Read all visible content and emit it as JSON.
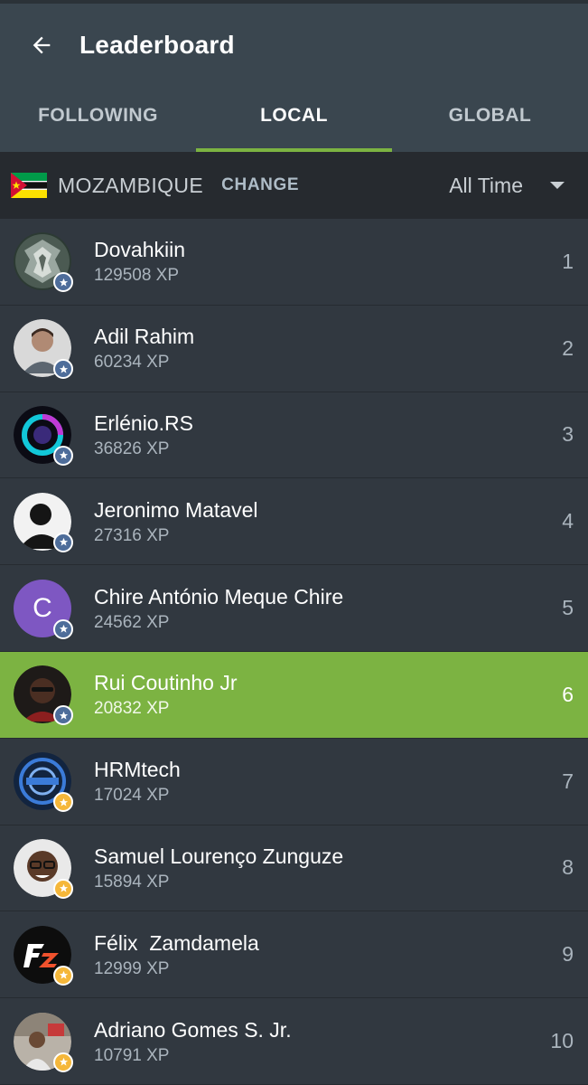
{
  "header": {
    "title": "Leaderboard",
    "back_icon": "arrow-left-icon"
  },
  "tabs": [
    {
      "label": "FOLLOWING",
      "active": false
    },
    {
      "label": "LOCAL",
      "active": true
    },
    {
      "label": "GLOBAL",
      "active": false
    }
  ],
  "filter": {
    "country": "MOZAMBIQUE",
    "change_label": "CHANGE",
    "period": "All Time",
    "flag_icon": "mozambique-flag-icon"
  },
  "colors": {
    "accent": "#7cb342",
    "appbar": "#3a464f",
    "row": "#313840"
  },
  "entries": [
    {
      "name": "Dovahkiin",
      "xp": "129508 XP",
      "rank": "1",
      "badge": "blue",
      "avatar": "dragon"
    },
    {
      "name": "Adil Rahim",
      "xp": "60234 XP",
      "rank": "2",
      "badge": "blue",
      "avatar": "photo-grey"
    },
    {
      "name": "Erlénio.RS",
      "xp": "36826 XP",
      "rank": "3",
      "badge": "blue",
      "avatar": "ring"
    },
    {
      "name": "Jeronimo Matavel",
      "xp": "27316 XP",
      "rank": "4",
      "badge": "blue",
      "avatar": "silhouette"
    },
    {
      "name": "Chire António Meque Chire",
      "xp": "24562 XP",
      "rank": "5",
      "badge": "blue",
      "avatar": "letter",
      "letter": "C"
    },
    {
      "name": "Rui Coutinho Jr",
      "xp": "20832 XP",
      "rank": "6",
      "badge": "blue",
      "avatar": "photo-dark",
      "highlight": true
    },
    {
      "name": "HRMtech",
      "xp": "17024 XP",
      "rank": "7",
      "badge": "gold",
      "avatar": "logo-blue"
    },
    {
      "name": "Samuel Lourenço Zunguze",
      "xp": "15894 XP",
      "rank": "8",
      "badge": "gold",
      "avatar": "photo-face"
    },
    {
      "name": "Félix  Zamdamela",
      "xp": "12999 XP",
      "rank": "9",
      "badge": "gold",
      "avatar": "fz-logo"
    },
    {
      "name": "Adriano Gomes S. Jr.",
      "xp": "10791 XP",
      "rank": "10",
      "badge": "gold",
      "avatar": "photo-room"
    }
  ]
}
